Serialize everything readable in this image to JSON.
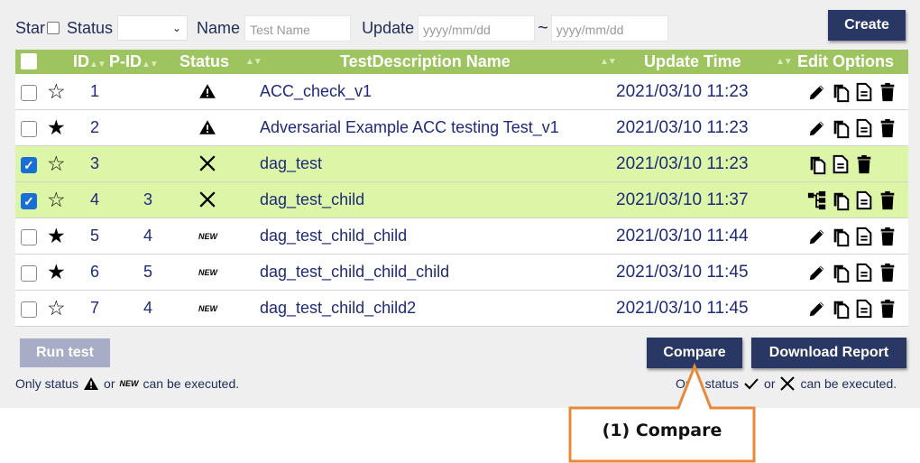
{
  "filters": {
    "star_label": "Star",
    "status_label": "Status",
    "name_label": "Name",
    "name_placeholder": "Test Name",
    "update_label": "Update",
    "date_from_placeholder": "yyyy/mm/dd",
    "range_sep": "~",
    "date_to_placeholder": "yyyy/mm/dd"
  },
  "create_label": "Create",
  "table": {
    "headers": {
      "id": "ID",
      "pid": "P-ID",
      "status": "Status",
      "name": "TestDescription Name",
      "update": "Update Time",
      "edit": "Edit Options"
    },
    "rows": [
      {
        "checked": false,
        "starred": false,
        "id": "1",
        "pid": "",
        "status": "warning",
        "name": "ACC_check_v1",
        "time": "2021/03/10 11:23",
        "ops": [
          "edit",
          "copy",
          "document",
          "delete"
        ]
      },
      {
        "checked": false,
        "starred": true,
        "id": "2",
        "pid": "",
        "status": "warning",
        "name": "Adversarial Example ACC testing Test_v1",
        "time": "2021/03/10 11:23",
        "ops": [
          "edit",
          "copy",
          "document",
          "delete"
        ]
      },
      {
        "checked": true,
        "starred": false,
        "id": "3",
        "pid": "",
        "status": "failed",
        "name": "dag_test",
        "time": "2021/03/10 11:23",
        "ops": [
          "copy",
          "document",
          "delete"
        ]
      },
      {
        "checked": true,
        "starred": false,
        "id": "4",
        "pid": "3",
        "status": "failed",
        "name": "dag_test_child",
        "time": "2021/03/10 11:37",
        "ops": [
          "tree",
          "copy",
          "document",
          "delete"
        ]
      },
      {
        "checked": false,
        "starred": true,
        "id": "5",
        "pid": "4",
        "status": "new",
        "name": "dag_test_child_child",
        "time": "2021/03/10 11:44",
        "ops": [
          "edit",
          "copy",
          "document",
          "delete"
        ]
      },
      {
        "checked": false,
        "starred": true,
        "id": "6",
        "pid": "5",
        "status": "new",
        "name": "dag_test_child_child_child",
        "time": "2021/03/10 11:45",
        "ops": [
          "edit",
          "copy",
          "document",
          "delete"
        ]
      },
      {
        "checked": false,
        "starred": false,
        "id": "7",
        "pid": "4",
        "status": "new",
        "name": "dag_test_child_child2",
        "time": "2021/03/10 11:45",
        "ops": [
          "edit",
          "copy",
          "document",
          "delete"
        ]
      }
    ]
  },
  "new_badge": "NEW",
  "run_test_label": "Run test",
  "note_left": {
    "prefix": "Only status",
    "or": "or",
    "suffix": "can be executed."
  },
  "note_right": {
    "prefix": "Only status",
    "or": "or",
    "suffix": "can be executed."
  },
  "compare_label": "Compare",
  "download_label": "Download Report",
  "callout_label": "(1) Compare",
  "colors": {
    "header": "#9dc45e",
    "selected_row": "#ddf5a6",
    "button": "#283763",
    "disabled_button": "#a9acc7",
    "callout": "#e8893a"
  }
}
